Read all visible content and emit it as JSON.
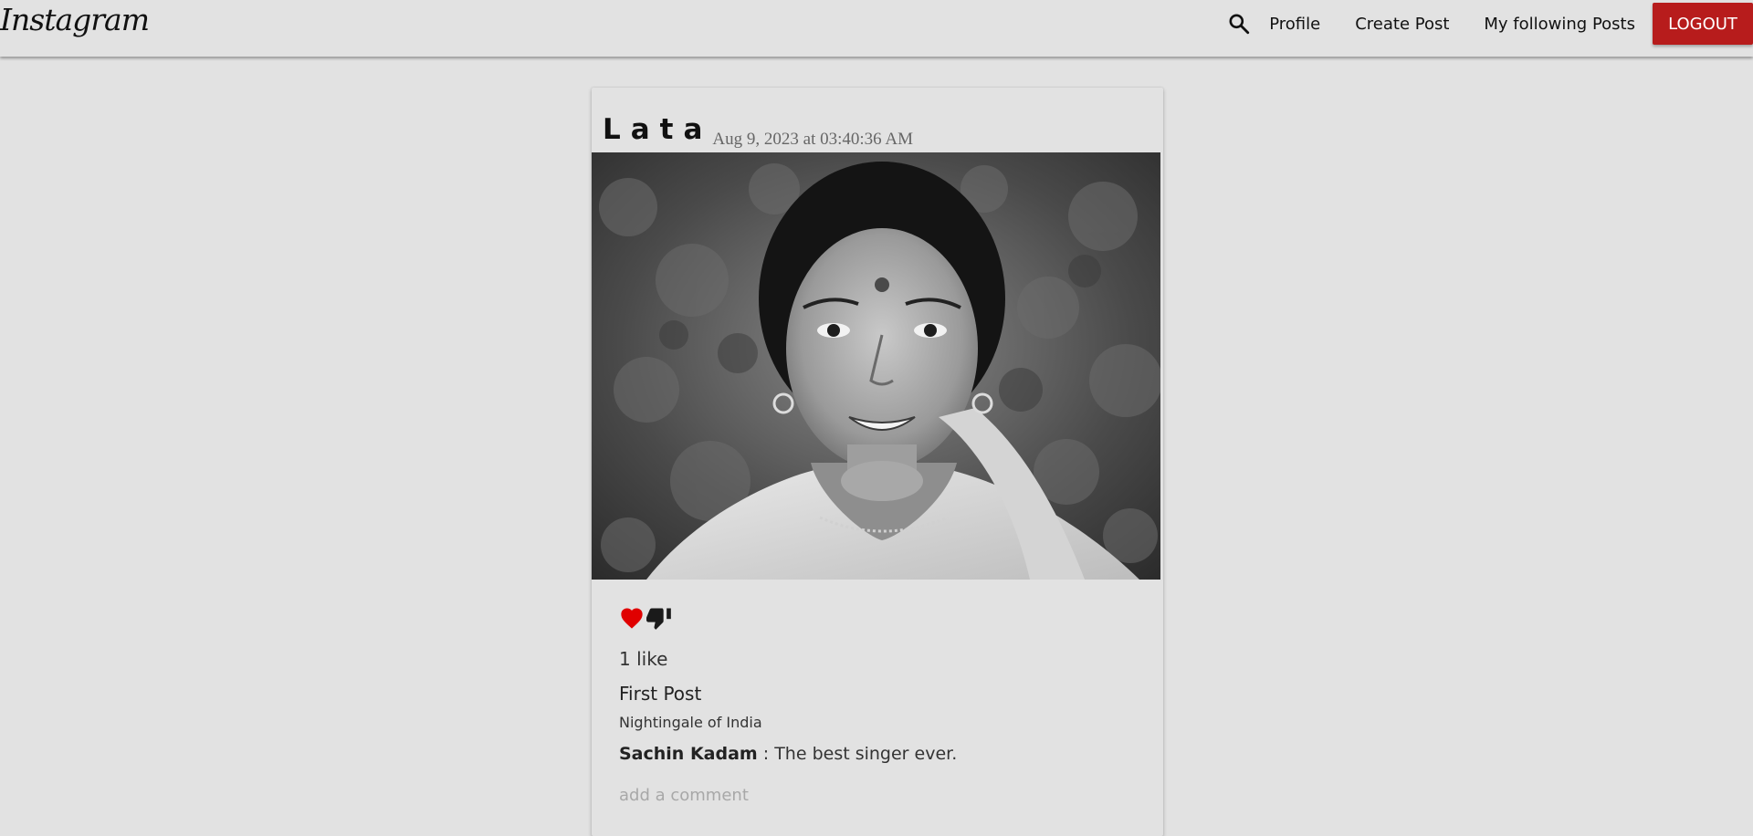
{
  "navbar": {
    "brand": "Instagram",
    "search_icon": "search-icon",
    "links": [
      "Profile",
      "Create Post",
      "My following Posts"
    ],
    "logout_label": "LOGOUT",
    "logout_color": "#b71c1c"
  },
  "post": {
    "author": "Lata",
    "date": "Aug 9, 2023 at 03:40:36 AM",
    "image_icon": "portrait-photo",
    "like_icon": "heart-icon",
    "like_color": "#e00000",
    "dislike_icon": "thumbs-down-icon",
    "likes_text": "1 like",
    "title": "First Post",
    "body": "Nightingale of India",
    "comments": [
      {
        "author": "Sachin Kadam",
        "text": " : The best singer ever."
      }
    ],
    "comment_placeholder": "add a comment"
  }
}
